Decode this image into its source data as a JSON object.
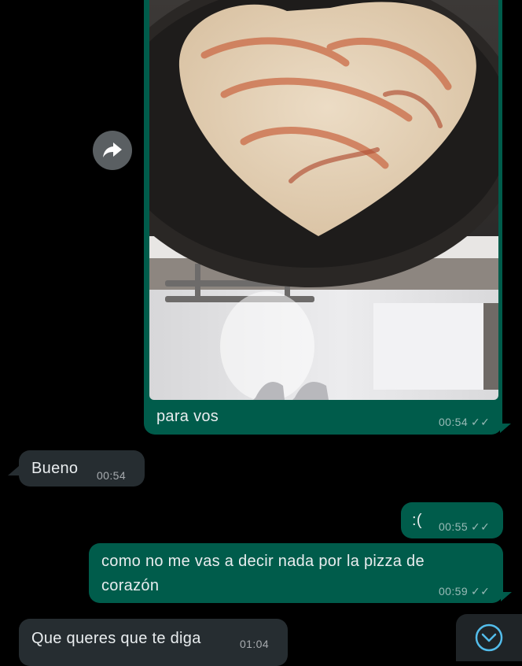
{
  "chat": {
    "messages": [
      {
        "direction": "outgoing",
        "type": "image",
        "caption": "para vos",
        "time": "00:54",
        "status": "read"
      },
      {
        "direction": "incoming",
        "text": "Bueno",
        "time": "00:54"
      },
      {
        "direction": "outgoing",
        "text": ":(",
        "time": "00:55",
        "status": "read"
      },
      {
        "direction": "outgoing",
        "text_lines": [
          "como no me vas a decir nada por la pizza de",
          "corazón"
        ],
        "time": "00:59",
        "status": "read"
      },
      {
        "direction": "incoming",
        "text": "Que queres que te diga",
        "time": "01:04"
      }
    ]
  },
  "icons": {
    "forward": "forward-arrow-icon",
    "scroll_down": "chevron-down-circle-icon",
    "read_ticks": "double-check-icon"
  },
  "colors": {
    "background": "#000000",
    "outgoing_bubble": "#005c4b",
    "incoming_bubble": "#262d31"
  }
}
